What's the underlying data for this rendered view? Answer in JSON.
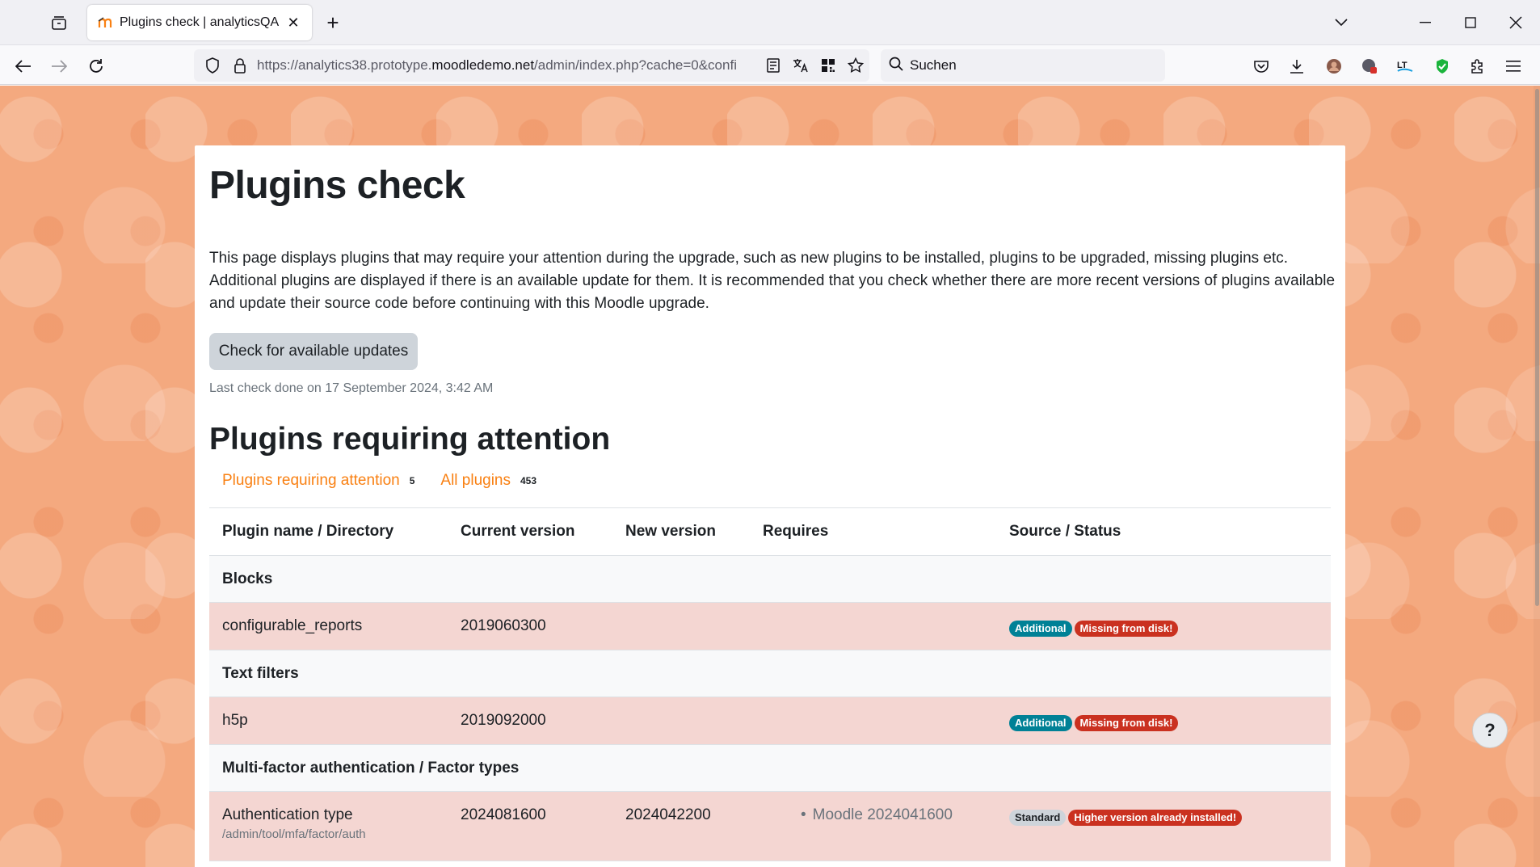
{
  "browser": {
    "tab": {
      "title": "Plugins check | analyticsQA"
    },
    "url": {
      "prefix": "https://analytics38.prototype.",
      "domain": "moodledemo.net",
      "path": "/admin/index.php?cache=0&confi"
    },
    "search": {
      "placeholder": "Suchen"
    }
  },
  "page": {
    "title": "Plugins check",
    "intro": "This page displays plugins that may require your attention during the upgrade, such as new plugins to be installed, plugins to be upgraded, missing plugins etc. Additional plugins are displayed if there is an available update for them. It is recommended that you check whether there are more recent versions of plugins available and update their source code before continuing with this Moodle upgrade.",
    "check_button": "Check for available updates",
    "last_check": "Last check done on 17 September 2024, 3:42 AM",
    "section_title": "Plugins requiring attention",
    "filters": [
      {
        "label": "Plugins requiring attention",
        "count": "5"
      },
      {
        "label": "All plugins",
        "count": "453"
      }
    ],
    "table": {
      "headers": [
        "Plugin name / Directory",
        "Current version",
        "New version",
        "Requires",
        "Source / Status"
      ],
      "groups": [
        {
          "name": "Blocks",
          "rows": [
            {
              "name": "configurable_reports",
              "current": "2019060300",
              "new": "",
              "requires": "",
              "source": "Additional",
              "status": "Missing from disk!"
            }
          ]
        },
        {
          "name": "Text filters",
          "rows": [
            {
              "name": "h5p",
              "current": "2019092000",
              "new": "",
              "requires": "",
              "source": "Additional",
              "status": "Missing from disk!"
            }
          ]
        },
        {
          "name": "Multi-factor authentication / Factor types",
          "rows": [
            {
              "name": "Authentication type",
              "dir": "/admin/tool/mfa/factor/auth",
              "current": "2024081600",
              "new": "2024042200",
              "requires": "Moodle 2024041600",
              "source": "Standard",
              "status": "Higher version already installed!"
            }
          ]
        }
      ]
    },
    "help_label": "?"
  }
}
